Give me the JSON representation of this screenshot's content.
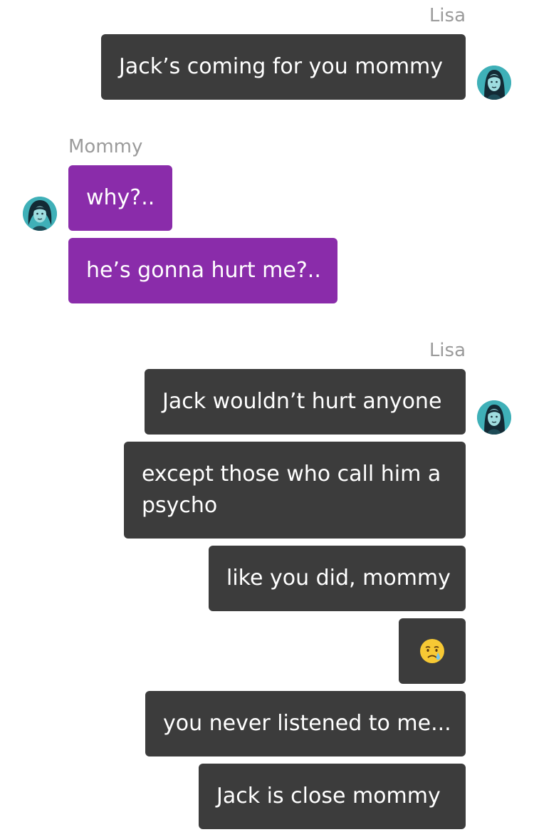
{
  "conversation": {
    "groups": [
      {
        "sender": "Lisa",
        "messages": [
          "Jack’s coming for you mommy"
        ]
      },
      {
        "sender": "Mommy",
        "messages": [
          "why?..",
          "he’s gonna hurt me?.."
        ]
      },
      {
        "sender": "Lisa",
        "messages": [
          "Jack wouldn’t hurt anyone",
          "except those who call him a psycho",
          "like you did, mommy",
          "😢",
          "you never listened to me...",
          "Jack is close mommy"
        ]
      }
    ]
  },
  "avatars": {
    "lisa_icon": "girl-avatar-icon",
    "mommy_icon": "woman-avatar-icon"
  },
  "colors": {
    "outgoing_bubble": "#3c3c3c",
    "incoming_bubble": "#8a2caa",
    "sender_label": "#9b9b9b",
    "avatar_bg": "#3fb0b8"
  }
}
